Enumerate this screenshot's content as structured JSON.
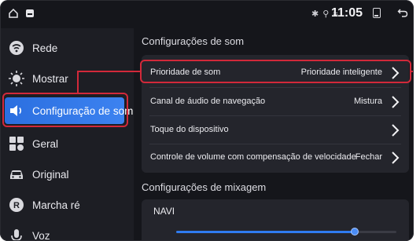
{
  "status_bar": {
    "time": "11:05",
    "status_icons": "✱ ⚲ ≈"
  },
  "sidebar": {
    "items": [
      {
        "label": "Rede",
        "icon": "network-icon"
      },
      {
        "label": "Mostrar",
        "icon": "brightness-icon"
      },
      {
        "label": "Configuração de som",
        "icon": "speaker-icon",
        "active": true
      },
      {
        "label": "Geral",
        "icon": "grid-icon"
      },
      {
        "label": "Original",
        "icon": "car-icon"
      },
      {
        "label": "Marcha ré",
        "icon": "reverse-icon"
      },
      {
        "label": "Voz",
        "icon": "microphone-icon"
      }
    ]
  },
  "main": {
    "sound_settings_title": "Configurações de som",
    "rows": [
      {
        "label": "Prioridade de som",
        "value": "Prioridade inteligente"
      },
      {
        "label": "Canal de áudio de navegação",
        "value": "Mistura"
      },
      {
        "label": "Toque do dispositivo",
        "value": ""
      },
      {
        "label": "Controle de volume com compensação de velocidade",
        "value": "Fechar"
      }
    ],
    "mix_title": "Configurações de mixagem",
    "mix": {
      "navi_label": "NAVI",
      "navi_level": 0.81
    }
  },
  "colors": {
    "accent": "#3178ea",
    "annotation": "#d2293a",
    "background": "#15161b"
  }
}
